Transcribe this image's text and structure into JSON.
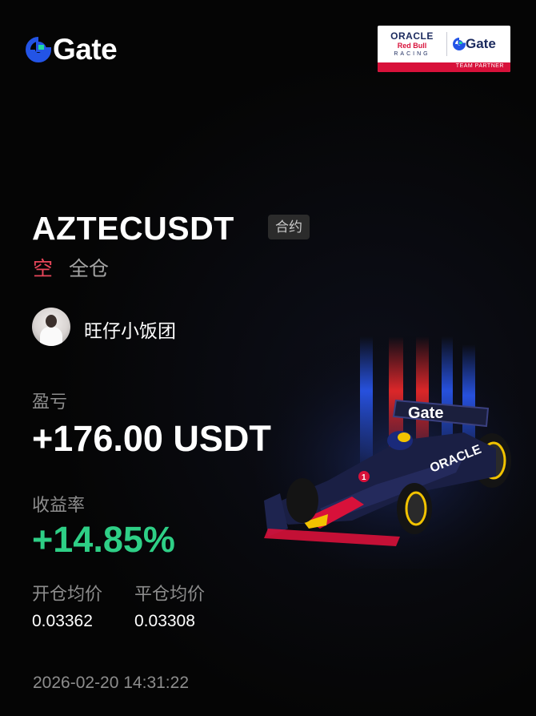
{
  "brand": {
    "logo_text": "Gate"
  },
  "partner": {
    "oracle": "ORACLE",
    "redbull": "Red Bull",
    "racing": "RACING",
    "gate": "Gate",
    "footer": "TEAM PARTNER"
  },
  "position": {
    "symbol": "AZTECUSDT",
    "tag": "合约",
    "side": "空",
    "margin_mode": "全仓"
  },
  "user": {
    "name": "旺仔小饭团"
  },
  "pnl": {
    "label": "盈亏",
    "value": "+176.00 USDT"
  },
  "roi": {
    "label": "收益率",
    "value": "+14.85%"
  },
  "prices": {
    "open_label": "开仓均价",
    "close_label": "平仓均价",
    "open_value": "0.03362",
    "close_value": "0.03308"
  },
  "timestamp": "2026-02-20 14:31:22",
  "car_livery": {
    "car_text": "Gate",
    "sidepod_text": "ORACLE",
    "number": "1"
  },
  "colors": {
    "background": "#050505",
    "short": "#e8465a",
    "profit": "#2ecf86",
    "muted": "#8d8d8d",
    "brand_blue": "#2354e6"
  }
}
